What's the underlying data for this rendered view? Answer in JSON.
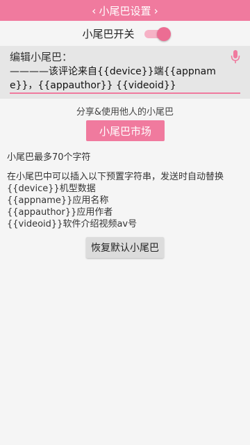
{
  "header": {
    "title": "小尾巴设置",
    "back_glyph": "‹",
    "forward_glyph": "›"
  },
  "toggle": {
    "label": "小尾巴开关",
    "on": true
  },
  "editor": {
    "label": "编辑小尾巴：",
    "value": "————该评论来自{{device}}端{{appname}}，{{appauthor}} {{videoid}}",
    "mic_icon": "microphone-icon"
  },
  "share_hint": "分享&使用他人的小尾巴",
  "market_button": "小尾巴市场",
  "limit_text": "小尾巴最多70个字符",
  "info": {
    "intro": "在小尾巴中可以插入以下预置字符串，发送时自动替换",
    "lines": [
      "{{device}}机型数据",
      "{{appname}}应用名称",
      "{{appauthor}}应用作者",
      "{{videoid}}软件介绍视频av号"
    ]
  },
  "restore_button": "恢复默认小尾巴",
  "colors": {
    "accent": "#f07a9e",
    "switch_thumb": "#ec6d93",
    "switch_track": "#f6b2c6",
    "edit_background": "#e6e6e6",
    "background": "#f5f5f5"
  }
}
